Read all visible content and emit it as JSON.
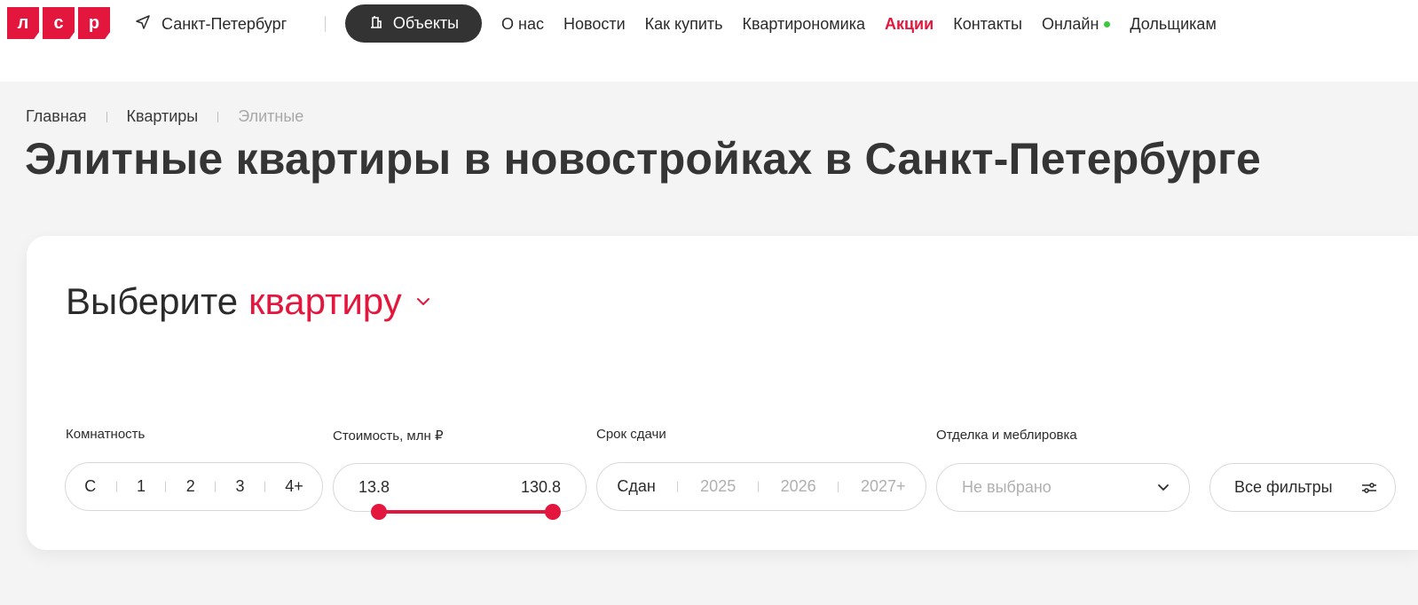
{
  "header": {
    "logo_letters": [
      "л",
      "с",
      "р"
    ],
    "city": "Санкт-Петербург",
    "objects_label": "Объекты",
    "nav": [
      "О нас",
      "Новости",
      "Как купить",
      "Квартирономика",
      "Акции",
      "Контакты",
      "Онлайн",
      "Дольщикам"
    ]
  },
  "breadcrumb": [
    "Главная",
    "Квартиры",
    "Элитные"
  ],
  "page_title": "Элитные квартиры в новостройках в Санкт-Петербурге",
  "selector": {
    "title_prefix": "Выберите",
    "title_accent": "квартиру"
  },
  "filters": {
    "rooms": {
      "label": "Комнатность",
      "options": [
        "С",
        "1",
        "2",
        "3",
        "4+"
      ]
    },
    "price": {
      "label": "Стоимость, млн ₽",
      "min": "13.8",
      "max": "130.8"
    },
    "deadline": {
      "label": "Срок сдачи",
      "options": [
        "Сдан",
        "2025",
        "2026",
        "2027+"
      ]
    },
    "finish": {
      "label": "Отделка и меблировка",
      "placeholder": "Не выбрано"
    },
    "all_filters_label": "Все фильтры"
  },
  "colors": {
    "accent": "#e3173e",
    "dark": "#333333",
    "online": "#3ec63e"
  }
}
